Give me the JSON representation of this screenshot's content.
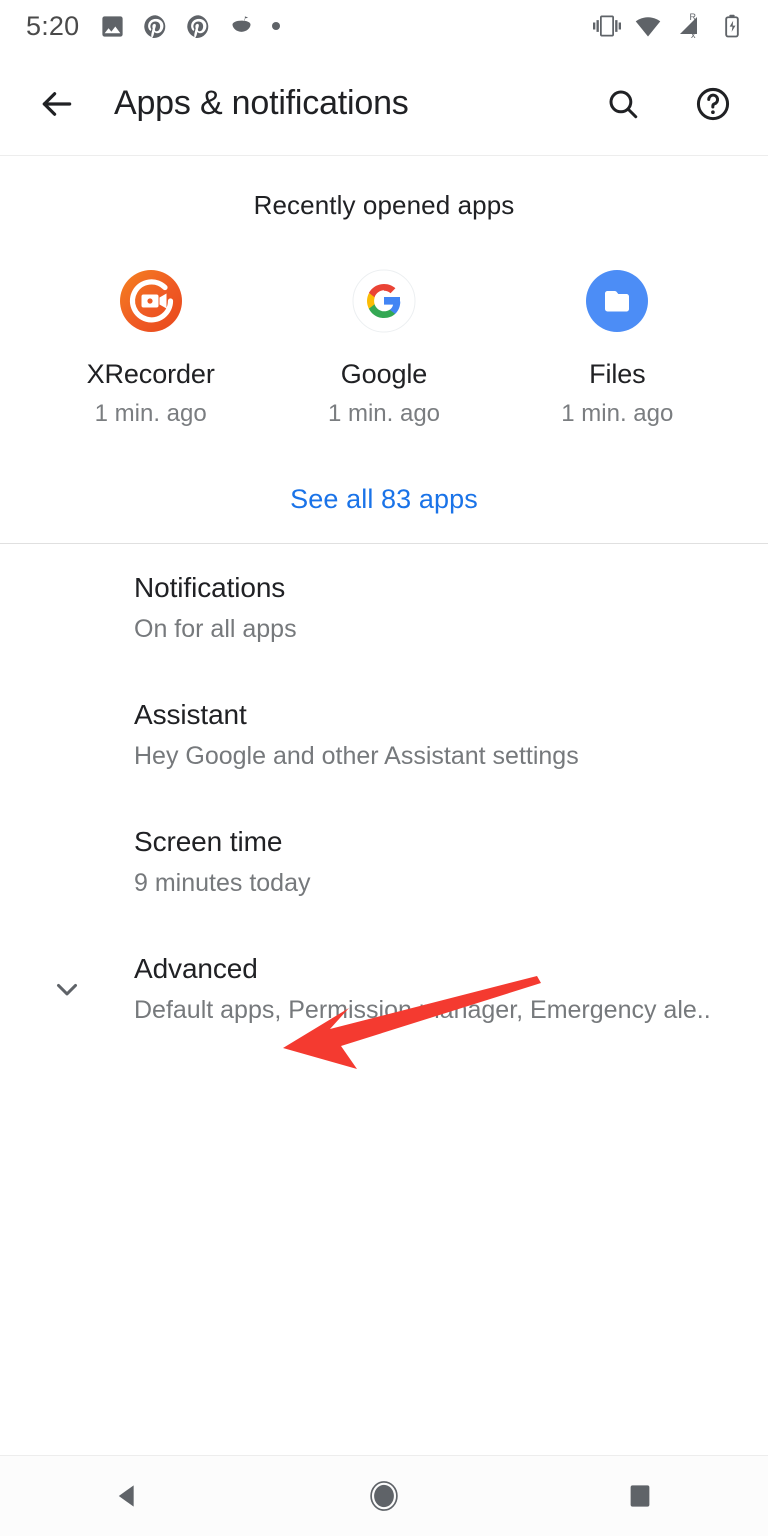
{
  "status_bar": {
    "time": "5:20",
    "left_icons": [
      "photo-icon",
      "pinterest-icon",
      "pinterest-icon",
      "bowl-flag-icon",
      "dot-icon"
    ],
    "right_icons": [
      "vibrate-icon",
      "wifi-icon",
      "cellular-roaming-no-service-icon",
      "battery-charging-icon"
    ],
    "cellular_roaming_label": "R",
    "cellular_no_service_label": "x"
  },
  "app_bar": {
    "back_icon": "arrow-back-icon",
    "title": "Apps & notifications",
    "search_icon": "search-icon",
    "help_icon": "help-circle-icon"
  },
  "recent": {
    "header": "Recently opened apps",
    "apps": [
      {
        "name": "XRecorder",
        "time": "1 min. ago",
        "icon": "xrecorder-icon"
      },
      {
        "name": "Google",
        "time": "1 min. ago",
        "icon": "google-g-icon"
      },
      {
        "name": "Files",
        "time": "1 min. ago",
        "icon": "files-folder-icon"
      }
    ],
    "see_all_label": "See all 83 apps"
  },
  "settings": [
    {
      "title": "Notifications",
      "subtitle": "On for all apps"
    },
    {
      "title": "Assistant",
      "subtitle": "Hey Google and other Assistant settings"
    },
    {
      "title": "Screen time",
      "subtitle": "9 minutes today"
    },
    {
      "title": "Advanced",
      "subtitle": "Default apps, Permission manager, Emergency ale..",
      "leading_icon": "chevron-down-icon"
    }
  ],
  "annotation": {
    "type": "arrow",
    "color": "#f43a30",
    "points_at": "Advanced"
  },
  "nav_bar": {
    "back_icon": "nav-back-triangle-icon",
    "home_icon": "nav-home-circle-icon",
    "recents_icon": "nav-recents-square-icon"
  },
  "colors": {
    "accent_link": "#1a73e8",
    "title_text": "#202124",
    "secondary_text": "#76797c",
    "annotation_red": "#f43a30",
    "status_icon": "#5f6368",
    "xrecorder_orange": "#f26722",
    "files_blue": "#4c8df6"
  }
}
